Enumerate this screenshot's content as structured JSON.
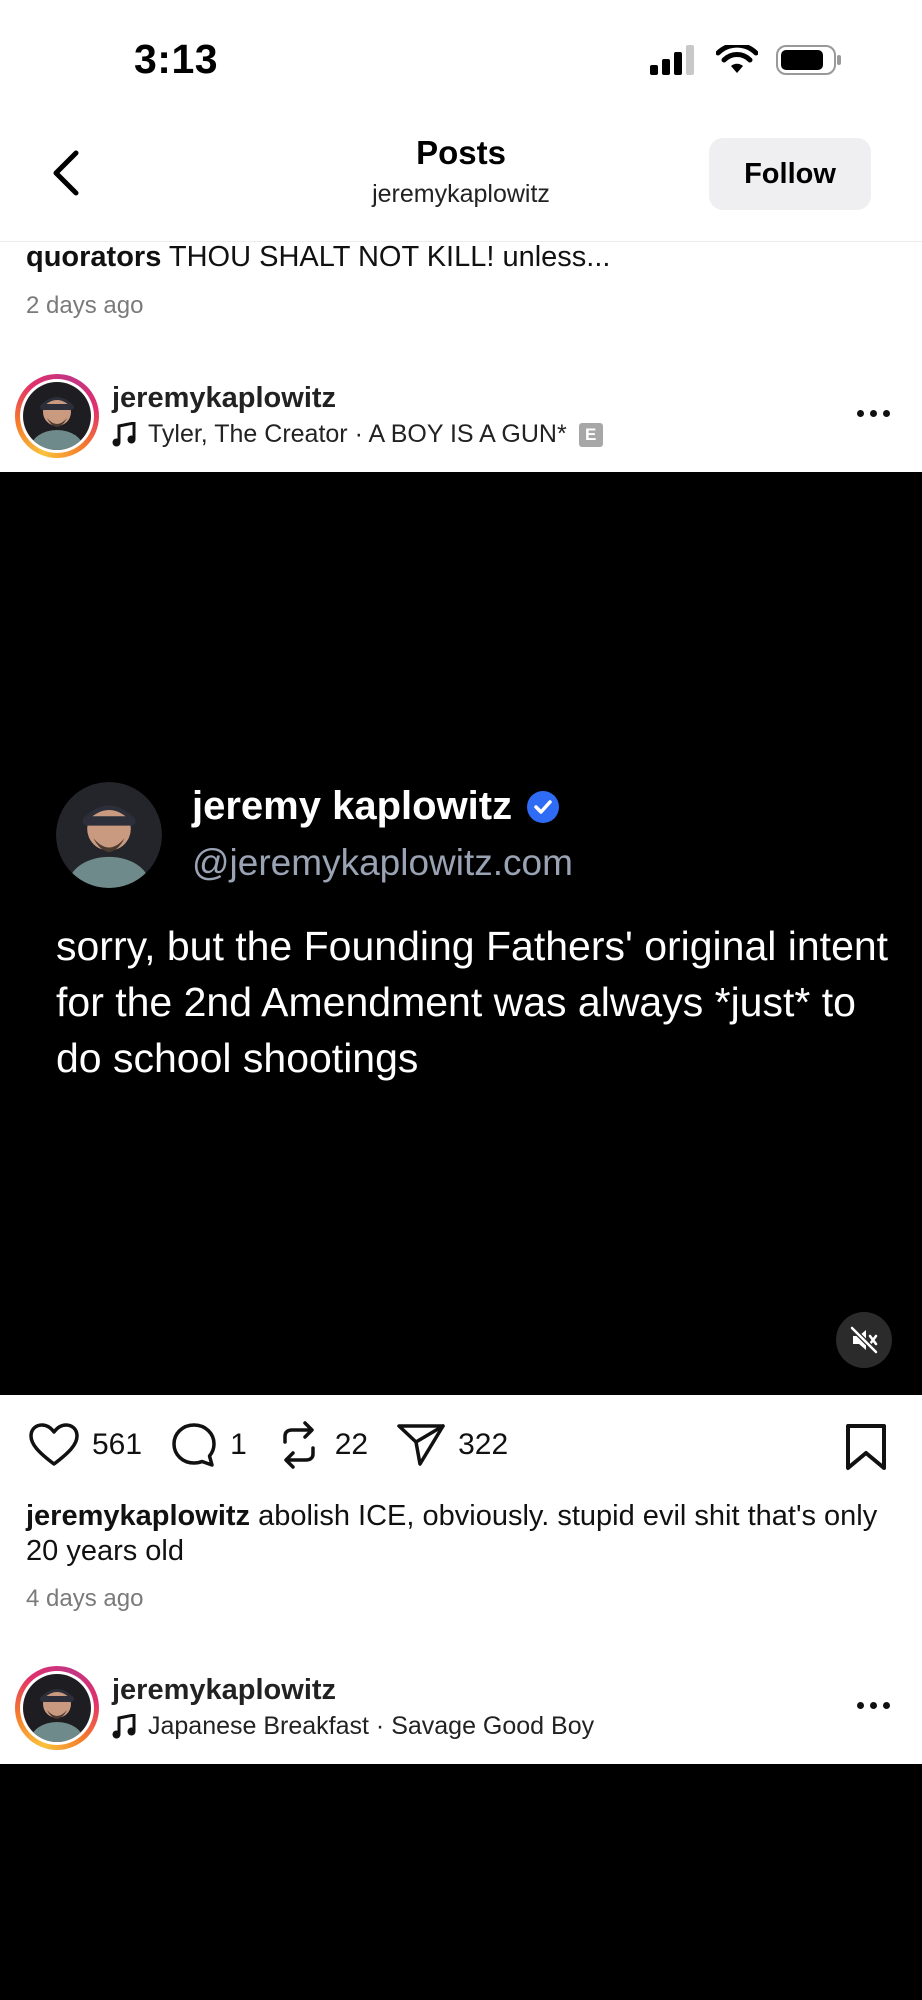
{
  "status_bar": {
    "time": "3:13"
  },
  "nav": {
    "title": "Posts",
    "subtitle": "jeremykaplowitz",
    "follow_label": "Follow"
  },
  "prev_post": {
    "caption_user": "quorators",
    "caption_text": "THOU SHALT NOT KILL! unless...",
    "time_ago": "2 days ago"
  },
  "post": {
    "username": "jeremykaplowitz",
    "music": "Tyler, The Creator · A BOY IS A GUN*",
    "explicit_badge": "E",
    "media": {
      "display_name": "jeremy kaplowitz",
      "handle": "@jeremykaplowitz.com",
      "text": "sorry, but the Founding Fathers' original intent for the 2nd Amendment was always *just* to do school shootings"
    },
    "stats": {
      "likes": "561",
      "comments": "1",
      "reposts": "22",
      "shares": "322"
    },
    "caption_user": "jeremykaplowitz",
    "caption_text": "abolish ICE, obviously. stupid evil shit that's only 20 years old",
    "time_ago": "4 days ago"
  },
  "next_post": {
    "username": "jeremykaplowitz",
    "music": "Japanese Breakfast · Savage Good Boy"
  }
}
